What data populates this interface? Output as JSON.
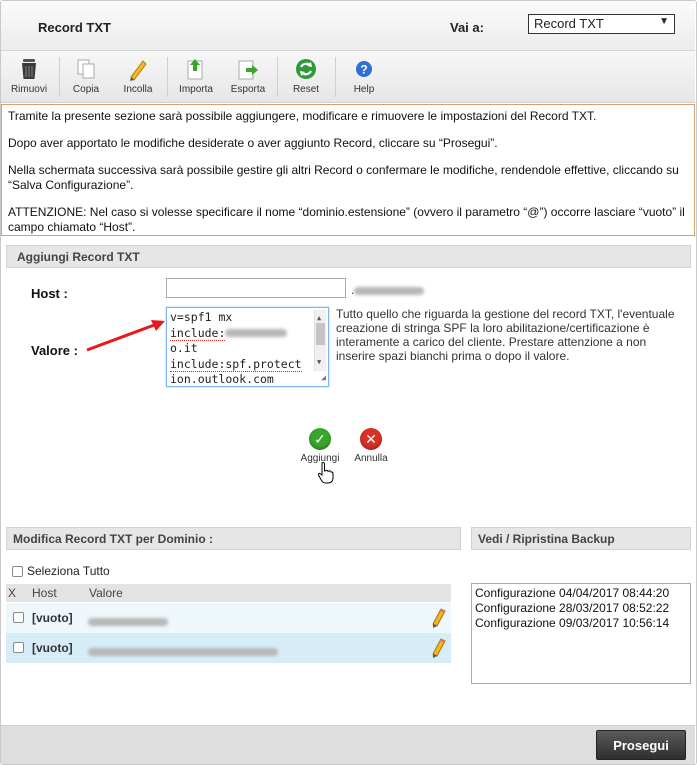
{
  "header": {
    "title": "Record TXT",
    "goto_label": "Vai a:",
    "goto_value": "Record TXT"
  },
  "toolbar": {
    "items": [
      {
        "label": "Rimuovi",
        "icon": "trash-icon"
      },
      {
        "label": "Copia",
        "icon": "copy-icon"
      },
      {
        "label": "Incolla",
        "icon": "paste-icon"
      },
      {
        "label": "Importa",
        "icon": "import-icon"
      },
      {
        "label": "Esporta",
        "icon": "export-icon"
      },
      {
        "label": "Reset",
        "icon": "reset-icon"
      },
      {
        "label": "Help",
        "icon": "help-icon"
      }
    ]
  },
  "info": {
    "p1": "Tramite la presente sezione sarà possibile aggiungere, modificare e rimuovere le impostazioni del Record TXT.",
    "p2": "Dopo aver apportato le modifiche desiderate o aver aggiunto Record, cliccare su “Prosegui”.",
    "p3": "Nella schermata successiva sarà possibile gestire gli altri Record o confermare le modifiche, rendendole effettive, cliccando su “Salva Configurazione”.",
    "p4": "ATTENZIONE: Nel caso si volesse specificare il nome “dominio.estensione” (ovvero il parametro “@”) occorre lasciare “vuoto” il campo chiamato “Host”."
  },
  "add_section": {
    "title": "Aggiungi Record TXT",
    "host_label": "Host :",
    "host_value": "",
    "domain_suffix": ".",
    "valore_label": "Valore :",
    "valore_lines": [
      "v=spf1 mx",
      "include:",
      "o.it",
      "include:spf.protect",
      "ion.outlook.com"
    ],
    "hint": "Tutto quello che riguarda la gestione del record TXT, l'eventuale creazione di stringa SPF la loro abilitazione/certificazione è interamente a carico del cliente. Prestare attenzione a non inserire spazi bianchi prima o dopo il valore.",
    "add_label": "Aggiungi",
    "cancel_label": "Annulla"
  },
  "modify_section": {
    "title": "Modifica Record TXT per Dominio :",
    "select_all": "Seleziona Tutto",
    "columns": [
      "X",
      "Host",
      "Valore"
    ],
    "rows": [
      {
        "host": "[vuoto]",
        "value": ""
      },
      {
        "host": "[vuoto]",
        "value": ""
      }
    ]
  },
  "backup_section": {
    "title": "Vedi / Ripristina Backup",
    "items": [
      "Configurazione 04/04/2017 08:44:20",
      "Configurazione 28/03/2017 08:52:22",
      "Configurazione 09/03/2017 10:56:14"
    ]
  },
  "footer": {
    "prosegui_label": "Prosegui"
  },
  "colors": {
    "info_border": "#d8a06a",
    "row_alt": "#d6edf8",
    "add_green": "#3aa52c",
    "cancel_red": "#d93025",
    "arrow_red": "#e8191c"
  }
}
